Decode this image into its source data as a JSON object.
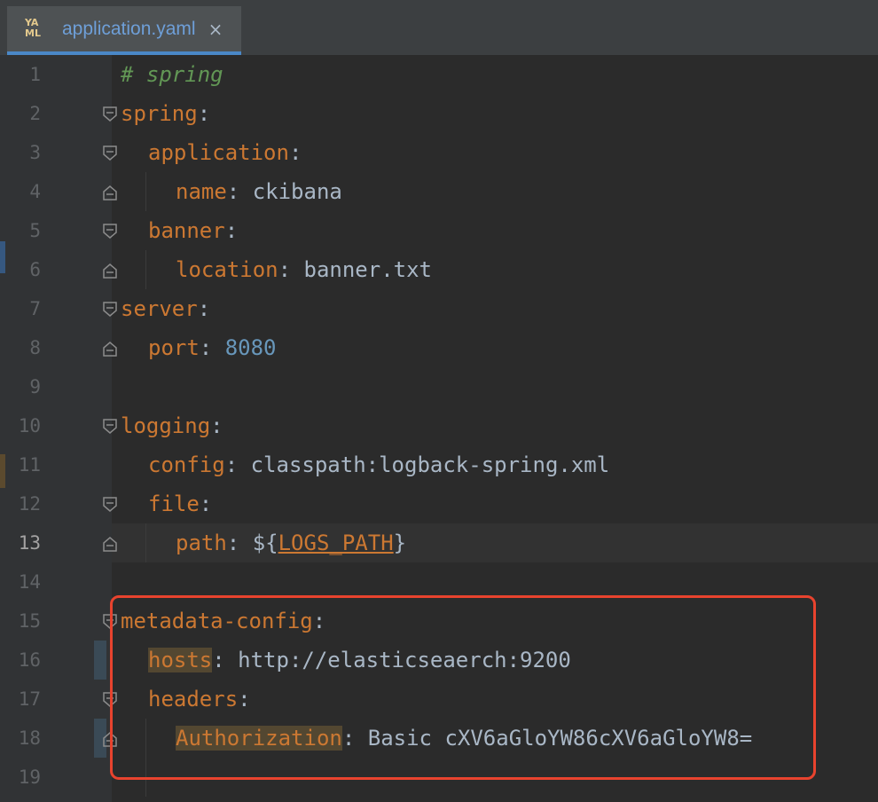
{
  "tab": {
    "icon": "yaml-file-icon",
    "icon_text_top": "YA",
    "icon_text_bottom": "ML",
    "title": "application.yaml",
    "close": "×"
  },
  "colors": {
    "key": "#cc7832",
    "comment": "#629755",
    "number": "#6897bb",
    "text": "#a9b7c6",
    "highlight_box": "#e8432e",
    "active_tab_underline": "#4a88c7"
  },
  "current_line": 13,
  "lines": [
    {
      "num": "1",
      "comment": "# spring"
    },
    {
      "num": "2",
      "key": "spring",
      "sep": ":"
    },
    {
      "num": "3",
      "key": "application",
      "sep": ":"
    },
    {
      "num": "4",
      "key": "name",
      "sep": ":",
      "value": " ckibana"
    },
    {
      "num": "5",
      "key": "banner",
      "sep": ":"
    },
    {
      "num": "6",
      "key": "location",
      "sep": ":",
      "value": " banner.txt"
    },
    {
      "num": "7",
      "key": "server",
      "sep": ":"
    },
    {
      "num": "8",
      "key": "port",
      "sep": ":",
      "number": " 8080"
    },
    {
      "num": "9"
    },
    {
      "num": "10",
      "key": "logging",
      "sep": ":"
    },
    {
      "num": "11",
      "key": "config",
      "sep": ":",
      "value": " classpath:logback-spring.xml"
    },
    {
      "num": "12",
      "key": "file",
      "sep": ":"
    },
    {
      "num": "13",
      "key": "path",
      "sep": ":",
      "value_pre": " ${",
      "var": "LOGS_PATH",
      "value_post": "}"
    },
    {
      "num": "14"
    },
    {
      "num": "15",
      "key": "metadata-config",
      "sep": ":"
    },
    {
      "num": "16",
      "key": "hosts",
      "sep": ":",
      "value": " http://elasticseaerch:9200"
    },
    {
      "num": "17",
      "key": "headers",
      "sep": ":"
    },
    {
      "num": "18",
      "key": "Authorization",
      "sep": ":",
      "value": " Basic cXV6aGloYW86cXV6aGloYW8="
    },
    {
      "num": "19"
    }
  ]
}
